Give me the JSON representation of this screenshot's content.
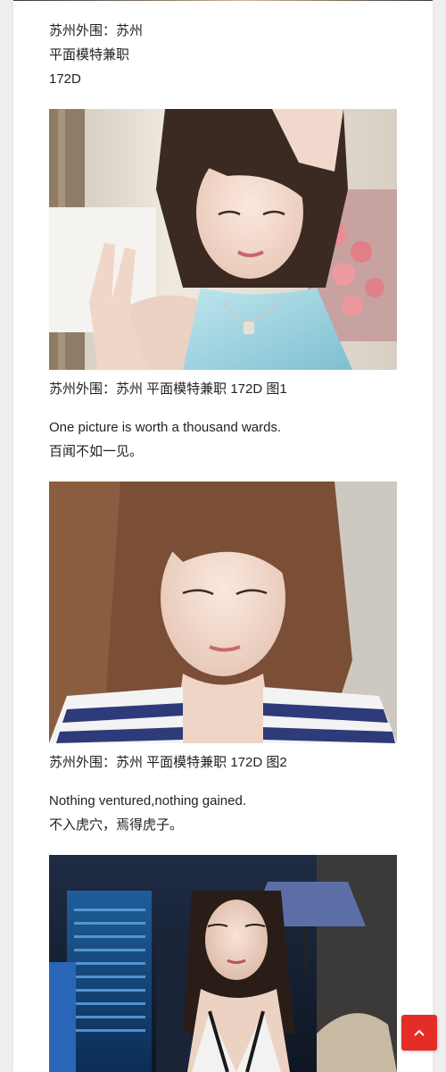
{
  "post": {
    "intro": {
      "line1": "苏州外围：苏州",
      "line2": "平面模特兼职",
      "line3": "172D"
    },
    "captions": [
      "苏州外围：苏州 平面模特兼职 172D 图1",
      "苏州外围：苏州 平面模特兼职 172D 图2"
    ],
    "quote1": {
      "en": "One picture is worth a thousand wards.",
      "zh": "百闻不如一见。"
    },
    "quote2": {
      "en": "Nothing ventured,nothing gained.",
      "zh": "不入虎穴，焉得虎子。"
    }
  },
  "scroll_top": {
    "icon": "chevron-up-icon",
    "color": "#e52d27"
  }
}
